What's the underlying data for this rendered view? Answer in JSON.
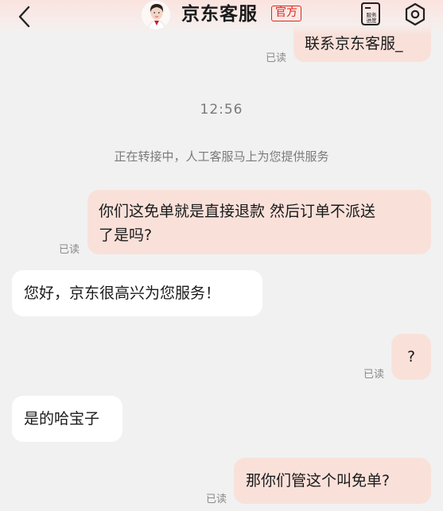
{
  "header": {
    "title": "京东客服",
    "badge": "官方",
    "service_progress_line1": "服务",
    "service_progress_line2": "进度",
    "back_icon": "chevron-left-icon",
    "settings_icon": "gear-icon",
    "accent_color": "#e1251b"
  },
  "messages": {
    "m0_text": "联系京东客服_",
    "m0_status": "已读",
    "time": "12:56",
    "system": "正在转接中，人工客服马上为您提供服务",
    "m1_line1": "你们这免单就是直接退款 然后订单不派送",
    "m1_line2": "了是吗?",
    "m1_status": "已读",
    "m2_text": "您好，京东很高兴为您服务！",
    "m3_text": "?",
    "m3_status": "已读",
    "m4_text": "是的哈宝子",
    "m5_text": "那你们管这个叫免单?",
    "m5_status": "已读"
  },
  "colors": {
    "outgoing_bubble": "#f9e1da",
    "incoming_bubble": "#ffffff",
    "background": "#f1f1f1"
  }
}
